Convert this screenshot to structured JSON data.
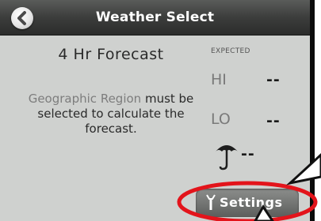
{
  "header": {
    "title": "Weather Select",
    "back_icon": "back-arrow-icon"
  },
  "left_panel": {
    "forecast_title": "4 Hr Forecast",
    "message_link": "Geographic Region",
    "message_rest": " must be selected to calculate the forecast."
  },
  "right_panel": {
    "expected_label": "EXPECTED",
    "hi_label": "HI",
    "hi_value": "--",
    "lo_label": "LO",
    "lo_value": "--",
    "rain_icon": "umbrella-icon",
    "rain_value": "--"
  },
  "footer": {
    "settings_label": "Settings",
    "settings_icon": "wrench-icon"
  },
  "colors": {
    "background": "#cfd1cf",
    "header": "#3c3d3c",
    "highlight": "#e3141b"
  }
}
